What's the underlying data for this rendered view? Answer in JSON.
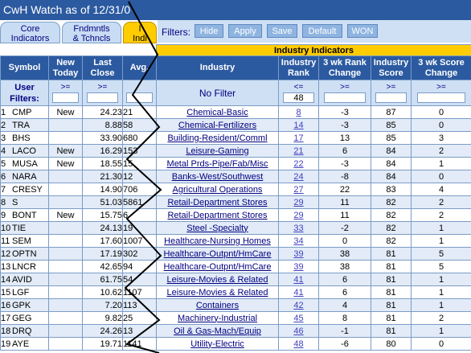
{
  "window": {
    "title": "CwH Watch as of 12/31/0"
  },
  "tabs": [
    {
      "line1": "Core",
      "line2": "Indicators"
    },
    {
      "line1": "Fndmntls",
      "line2": "& Tchncls"
    },
    {
      "line1": "I",
      "line2": "Indi"
    }
  ],
  "filters": {
    "label": "Filters:",
    "buttons": [
      "Hide",
      "Apply",
      "Save",
      "Default",
      "WON"
    ]
  },
  "group_header": "Industry Indicators",
  "columns": {
    "symbol": "Symbol",
    "new_today": "New Today",
    "last_close": "Last Close",
    "avg": "Avg.",
    "industry": "Industry",
    "industry_rank": "Industry Rank",
    "rank_change": "3 wk Rank Change",
    "industry_score": "Industry Score",
    "score_change": "3 wk Score Change"
  },
  "user_filters": {
    "label": "User Filters:",
    "new_today_op": ">=",
    "last_close_op": ">=",
    "industry_text": "No Filter",
    "industry_rank_op": "<=",
    "industry_rank_value": "48",
    "rank_change_op": ">=",
    "industry_score_op": ">=",
    "score_change_op": ">="
  },
  "rows": [
    {
      "n": "1",
      "symbol": "CMP",
      "new": "New",
      "close": "24.23",
      "avg": "21",
      "industry": "Chemical-Basic",
      "rank": "8",
      "rank_chg": "-3",
      "score": "87",
      "score_chg": "0"
    },
    {
      "n": "2",
      "symbol": "TRA",
      "new": "",
      "close": "8.88",
      "avg": "58",
      "industry": "Chemical-Fertilizers",
      "rank": "14",
      "rank_chg": "-3",
      "score": "85",
      "score_chg": "0"
    },
    {
      "n": "3",
      "symbol": "BHS",
      "new": "",
      "close": "33.90",
      "avg": "680",
      "industry": "Building-Resident/Comml",
      "rank": "17",
      "rank_chg": "13",
      "score": "85",
      "score_chg": "3"
    },
    {
      "n": "4",
      "symbol": "LACO",
      "new": "New",
      "close": "16.29",
      "avg": "153",
      "industry": "Leisure-Gaming",
      "rank": "21",
      "rank_chg": "6",
      "score": "84",
      "score_chg": "2"
    },
    {
      "n": "5",
      "symbol": "MUSA",
      "new": "New",
      "close": "18.55",
      "avg": "15",
      "industry": "Metal Prds-Pipe/Fab/Misc",
      "rank": "22",
      "rank_chg": "-3",
      "score": "84",
      "score_chg": "1"
    },
    {
      "n": "6",
      "symbol": "NARA",
      "new": "",
      "close": "21.30",
      "avg": "12",
      "industry": "Banks-West/Southwest",
      "rank": "24",
      "rank_chg": "-8",
      "score": "84",
      "score_chg": "0"
    },
    {
      "n": "7",
      "symbol": "CRESY",
      "new": "",
      "close": "14.90",
      "avg": "706",
      "industry": "Agricultural Operations",
      "rank": "27",
      "rank_chg": "22",
      "score": "83",
      "score_chg": "4"
    },
    {
      "n": "8",
      "symbol": "S",
      "new": "",
      "close": "51.03",
      "avg": "5861",
      "industry": "Retail-Department Stores",
      "rank": "29",
      "rank_chg": "11",
      "score": "82",
      "score_chg": "2"
    },
    {
      "n": "9",
      "symbol": "BONT",
      "new": "New",
      "close": "15.75",
      "avg": "6",
      "industry": "Retail-Department Stores",
      "rank": "29",
      "rank_chg": "11",
      "score": "82",
      "score_chg": "2"
    },
    {
      "n": "10",
      "symbol": "TIE",
      "new": "",
      "close": "24.13",
      "avg": "19",
      "industry": "Steel -Specialty",
      "rank": "33",
      "rank_chg": "-2",
      "score": "82",
      "score_chg": "1"
    },
    {
      "n": "11",
      "symbol": "SEM",
      "new": "",
      "close": "17.60",
      "avg": "1007",
      "industry": "Healthcare-Nursing Homes",
      "rank": "34",
      "rank_chg": "0",
      "score": "82",
      "score_chg": "1"
    },
    {
      "n": "12",
      "symbol": "OPTN",
      "new": "",
      "close": "17.19",
      "avg": "302",
      "industry": "Healthcare-Outpnt/HmCare",
      "rank": "39",
      "rank_chg": "38",
      "score": "81",
      "score_chg": "5"
    },
    {
      "n": "13",
      "symbol": "LNCR",
      "new": "",
      "close": "42.65",
      "avg": "94",
      "industry": "Healthcare-Outpnt/HmCare",
      "rank": "39",
      "rank_chg": "38",
      "score": "81",
      "score_chg": "5"
    },
    {
      "n": "14",
      "symbol": "AVID",
      "new": "",
      "close": "61.75",
      "avg": "54",
      "industry": "Leisure-Movies & Related",
      "rank": "41",
      "rank_chg": "6",
      "score": "81",
      "score_chg": "1"
    },
    {
      "n": "15",
      "symbol": "LGF",
      "new": "",
      "close": "10.62",
      "avg": "1107",
      "industry": "Leisure-Movies & Related",
      "rank": "41",
      "rank_chg": "6",
      "score": "81",
      "score_chg": "1"
    },
    {
      "n": "16",
      "symbol": "GPK",
      "new": "",
      "close": "7.20",
      "avg": "113",
      "industry": "Containers",
      "rank": "42",
      "rank_chg": "4",
      "score": "81",
      "score_chg": "1"
    },
    {
      "n": "17",
      "symbol": "GEG",
      "new": "",
      "close": "9.82",
      "avg": "25",
      "industry": "Machinery-Industrial",
      "rank": "45",
      "rank_chg": "8",
      "score": "81",
      "score_chg": "2"
    },
    {
      "n": "18",
      "symbol": "DRQ",
      "new": "",
      "close": "24.26",
      "avg": "13",
      "industry": "Oil & Gas-Mach/Equip",
      "rank": "46",
      "rank_chg": "-1",
      "score": "81",
      "score_chg": "1"
    },
    {
      "n": "19",
      "symbol": "AYE",
      "new": "",
      "close": "19.71",
      "avg": "1141",
      "industry": "Utility-Electric",
      "rank": "48",
      "rank_chg": "-6",
      "score": "80",
      "score_chg": "0"
    }
  ]
}
